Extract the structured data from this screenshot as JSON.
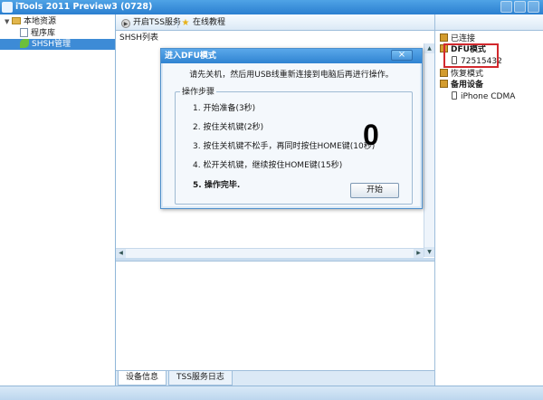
{
  "window": {
    "title": "iTools 2011 Preview3 (0728)"
  },
  "tree": {
    "root_label": "本地资源",
    "items": [
      {
        "label": "程序库"
      },
      {
        "label": "SHSH管理"
      }
    ]
  },
  "toolbar": {
    "btn_tss": "开启TSS服务",
    "btn_tutorial": "在线教程"
  },
  "main": {
    "list_label": "SHSH列表",
    "tabs": [
      {
        "label": "设备信息"
      },
      {
        "label": "TSS服务日志"
      }
    ]
  },
  "right_panel": {
    "connected": "已连接",
    "dfu_mode": "DFU模式",
    "dfu_device": "72515432",
    "recovery_mode": "恢复模式",
    "backup_devices": "备用设备",
    "backup_device": "iPhone CDMA"
  },
  "dialog": {
    "title": "进入DFU模式",
    "instruction": "请先关机，然后用USB线重新连接到电脑后再进行操作。",
    "group_label": "操作步骤",
    "steps": [
      "1. 开始准备(3秒)",
      "2. 按住关机键(2秒)",
      "3. 按住关机键不松手，再同时按住HOME键(10秒)",
      "4. 松开关机键，继续按住HOME键(15秒)",
      "5. 操作完毕."
    ],
    "countdown": "0",
    "start_button": "开始"
  }
}
